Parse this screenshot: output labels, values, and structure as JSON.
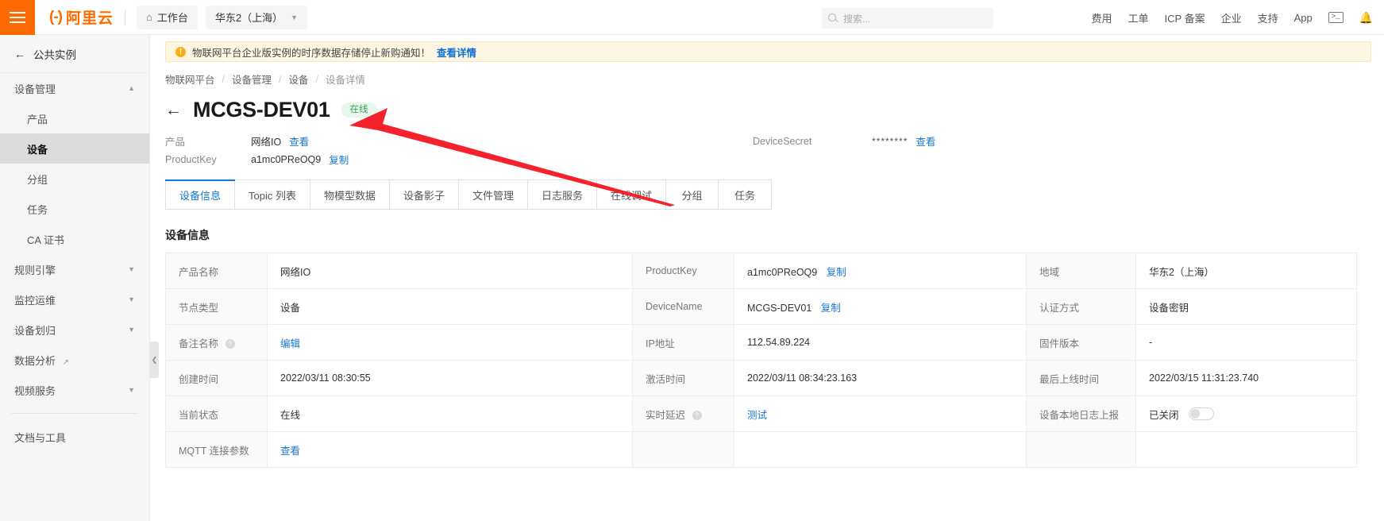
{
  "topbar": {
    "menu_icon": "hamburger-icon",
    "logo_text": "阿里云",
    "workbench_label": "工作台",
    "region_label": "华东2（上海）",
    "search_placeholder": "搜索...",
    "links": [
      "费用",
      "工单",
      "ICP 备案",
      "企业",
      "支持",
      "App"
    ],
    "cloudshell_icon": ">_",
    "bell_icon": "bell-icon"
  },
  "sidebar": {
    "back_label": "公共实例",
    "groups": [
      {
        "label": "设备管理",
        "expanded": true,
        "items": [
          "产品",
          "设备",
          "分组",
          "任务",
          "CA 证书"
        ],
        "active_item": "设备"
      },
      {
        "label": "规则引擎",
        "expanded": false,
        "items": []
      },
      {
        "label": "监控运维",
        "expanded": false,
        "items": []
      },
      {
        "label": "设备划归",
        "expanded": false,
        "items": []
      },
      {
        "label": "数据分析",
        "expanded": false,
        "external": true,
        "items": []
      },
      {
        "label": "视频服务",
        "expanded": false,
        "items": []
      }
    ],
    "footer_label": "文档与工具",
    "collapse_icon": "chevron-left-icon"
  },
  "notice": {
    "icon": "warning-icon",
    "text": "物联网平台企业版实例的时序数据存储停止新购通知！",
    "link": "查看详情"
  },
  "breadcrumb": [
    "物联网平台",
    "设备管理",
    "设备",
    "设备详情"
  ],
  "header": {
    "back_icon": "arrow-left-icon",
    "title": "MCGS-DEV01",
    "status": "在线"
  },
  "meta": {
    "product_label": "产品",
    "product_value": "网络IO",
    "product_link": "查看",
    "productkey_label": "ProductKey",
    "productkey_value": "a1mc0PReOQ9",
    "productkey_copy": "复制",
    "devicesecret_label": "DeviceSecret",
    "devicesecret_value": "********",
    "devicesecret_link": "查看"
  },
  "tabs": [
    {
      "label": "设备信息",
      "active": true
    },
    {
      "label": "Topic 列表",
      "active": false
    },
    {
      "label": "物模型数据",
      "active": false
    },
    {
      "label": "设备影子",
      "active": false
    },
    {
      "label": "文件管理",
      "active": false
    },
    {
      "label": "日志服务",
      "active": false
    },
    {
      "label": "在线调试",
      "active": false
    },
    {
      "label": "分组",
      "active": false
    },
    {
      "label": "任务",
      "active": false
    }
  ],
  "panel": {
    "title": "设备信息",
    "rows": [
      {
        "k1": "产品名称",
        "v1": "网络IO",
        "v1_link": "",
        "k2": "ProductKey",
        "v2": "a1mc0PReOQ9",
        "v2_link": "复制",
        "k3": "地域",
        "v3": "华东2（上海）",
        "v3_link": ""
      },
      {
        "k1": "节点类型",
        "v1": "设备",
        "v1_link": "",
        "k2": "DeviceName",
        "v2": "MCGS-DEV01",
        "v2_link": "复制",
        "k3": "认证方式",
        "v3": "设备密钥",
        "v3_link": ""
      },
      {
        "k1": "备注名称",
        "k1_help": true,
        "v1": "",
        "v1_link": "编辑",
        "k2": "IP地址",
        "v2": "112.54.89.224",
        "v2_link": "",
        "k3": "固件版本",
        "v3": "-",
        "v3_link": ""
      },
      {
        "k1": "创建时间",
        "v1": "2022/03/11 08:30:55",
        "v1_link": "",
        "k2": "激活时间",
        "v2": "2022/03/11 08:34:23.163",
        "v2_link": "",
        "k3": "最后上线时间",
        "v3": "2022/03/15 11:31:23.740",
        "v3_link": ""
      },
      {
        "k1": "当前状态",
        "v1": "在线",
        "v1_link": "",
        "k2": "实时延迟",
        "k2_help": true,
        "v2": "",
        "v2_link": "测试",
        "k3": "设备本地日志上报",
        "v3": "已关闭",
        "v3_toggle": true
      },
      {
        "k1": "MQTT 连接参数",
        "v1": "",
        "v1_link": "查看",
        "k2": "",
        "v2": "",
        "v2_link": "",
        "k3": "",
        "v3": "",
        "v3_link": ""
      }
    ]
  },
  "annotation": {
    "type": "arrow",
    "color": "#f5222d"
  },
  "colors": {
    "brand": "#ff6a00",
    "link": "#1677d2",
    "online": "#3aa45c",
    "notice_bg": "#fdf6e3"
  }
}
